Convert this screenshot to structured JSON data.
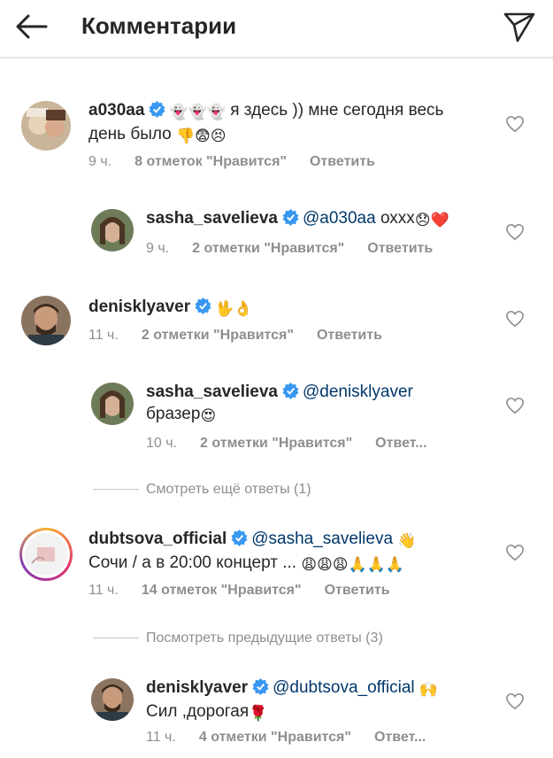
{
  "header": {
    "title": "Комментарии"
  },
  "comments": [
    {
      "username": "a030aa",
      "text": "я здесь )) мне сегодня весь день было",
      "emojis_1": "👻👻👻",
      "emojis_2": "👎😨😣",
      "time": "9 ч.",
      "likes": "8 отметок \"Нравится\"",
      "reply": "Ответить"
    },
    {
      "username": "sasha_savelieva",
      "mention": "@a030aa",
      "text": "охxx",
      "emojis": "😞❤️",
      "time": "9 ч.",
      "likes": "2 отметки \"Нравится\"",
      "reply": "Ответить"
    },
    {
      "username": "denisklyaver",
      "emojis": "🖖👌",
      "time": "11 ч.",
      "likes": "2 отметки \"Нравится\"",
      "reply": "Ответить"
    },
    {
      "username": "sasha_savelieva",
      "mention": "@denisklyaver",
      "text": "бразер",
      "emojis": "😍",
      "time": "10 ч.",
      "likes": "2 отметки \"Нравится\"",
      "reply": "Ответ..."
    },
    {
      "username": "dubtsova_official",
      "mention": "@sasha_savelieva",
      "emoji_inline": "👋",
      "text": "Сочи / а в 20:00 концерт ...",
      "emojis": "😩😩😩🙏🙏🙏",
      "time": "11 ч.",
      "likes": "14 отметок \"Нравится\"",
      "reply": "Ответить"
    },
    {
      "username": "denisklyaver",
      "mention": "@dubtsova_official",
      "emoji_inline": "🙌",
      "text": "Сил ,дорогая",
      "emojis": "🌹",
      "time": "11 ч.",
      "likes": "4 отметки \"Нравится\"",
      "reply": "Ответ..."
    }
  ],
  "view_more_1": "Смотреть ещё ответы (1)",
  "view_more_2": "Посмотреть предыдущие ответы (3)",
  "colors": {
    "mention": "#00376b",
    "verified": "#3897f0",
    "meta": "#8e8e8e"
  }
}
